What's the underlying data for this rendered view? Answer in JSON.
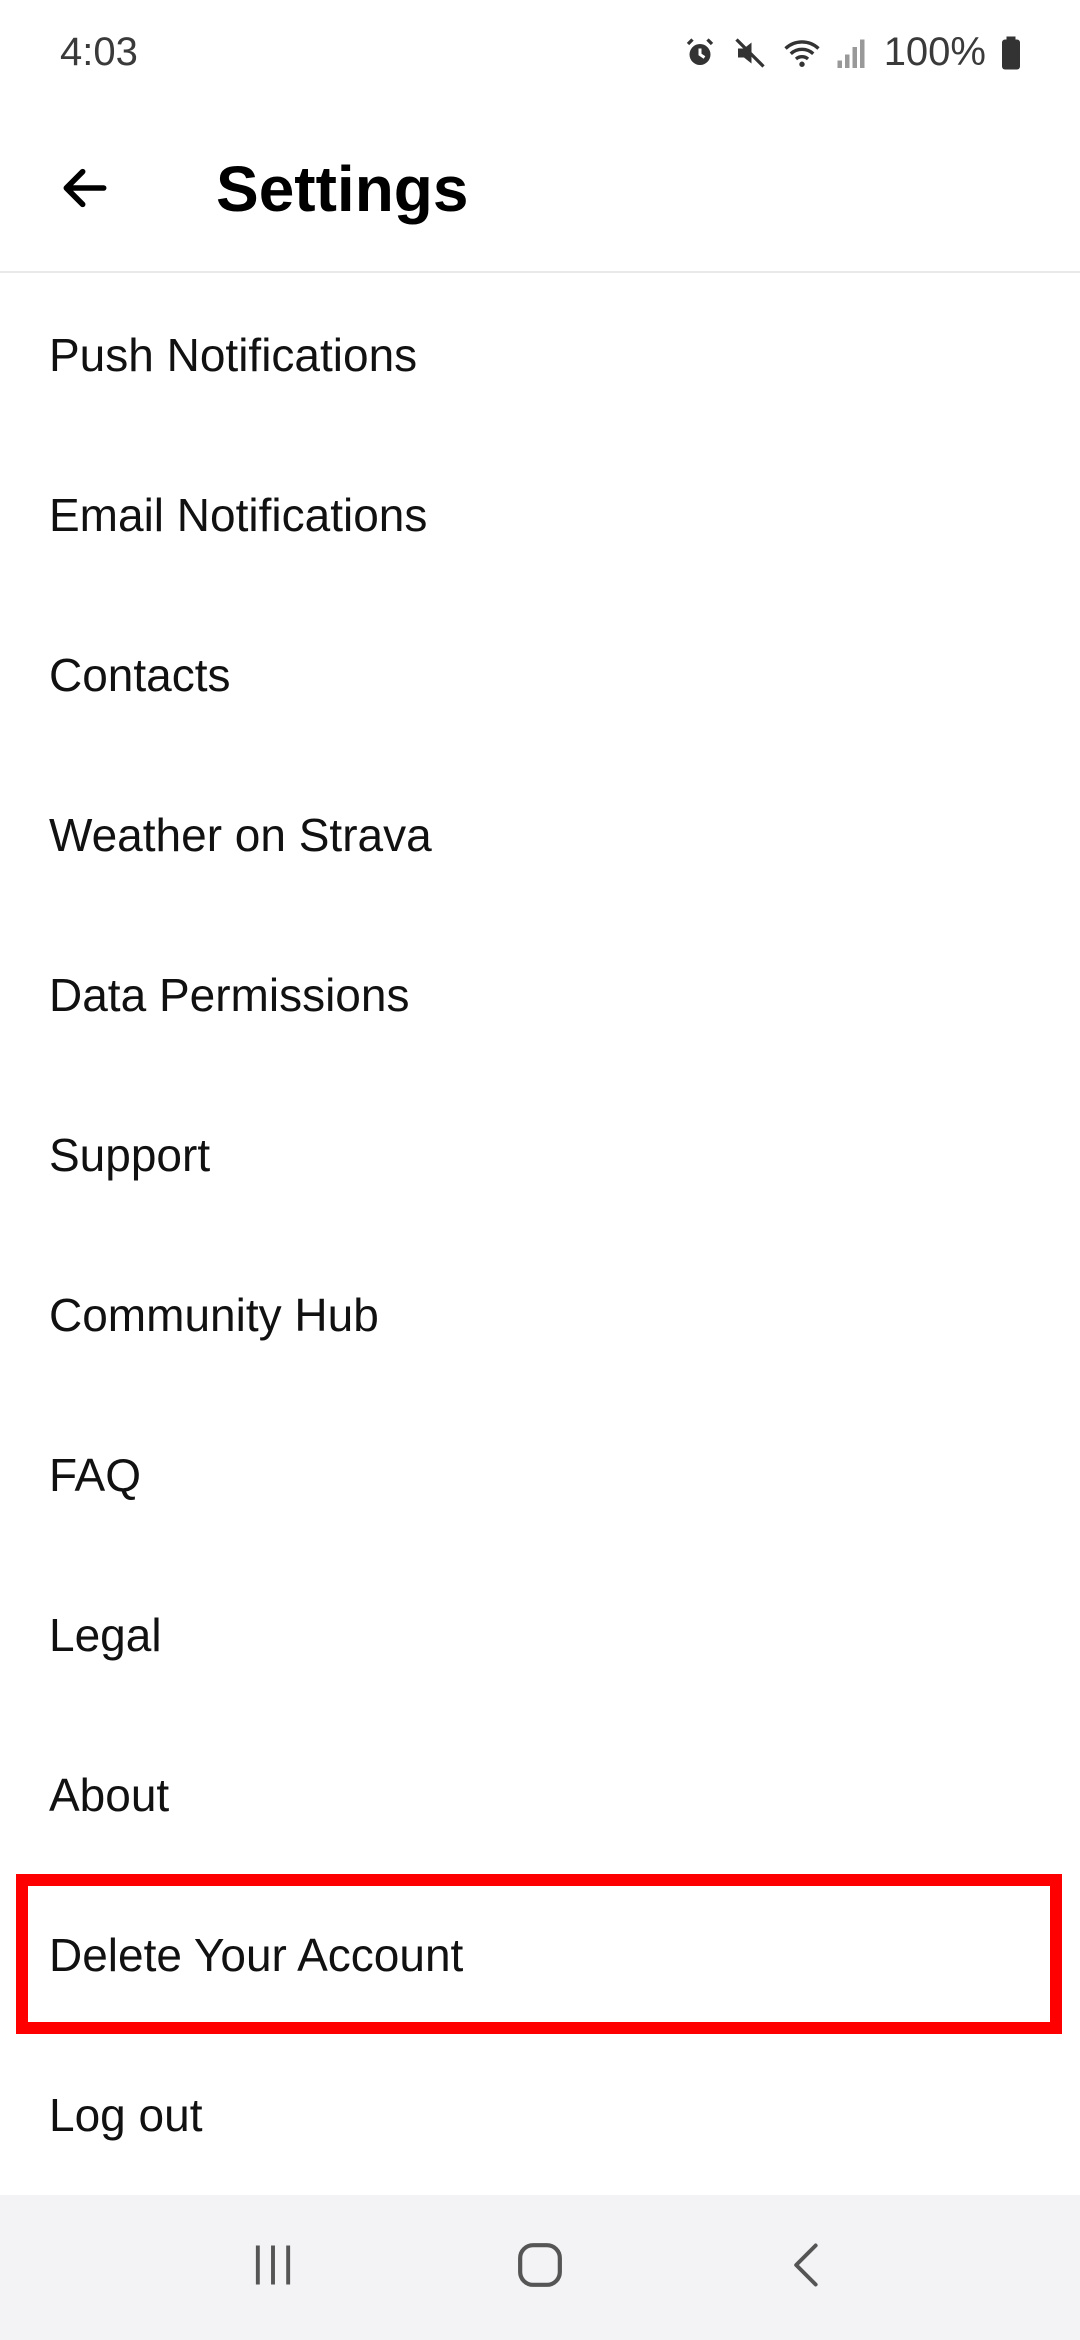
{
  "status_bar": {
    "time": "4:03",
    "battery": "100%",
    "icons": [
      "alarm-icon",
      "mute-icon",
      "wifi-icon",
      "signal-icon",
      "battery-icon"
    ]
  },
  "app_bar": {
    "title": "Settings",
    "back_icon": "arrow-left-icon"
  },
  "settings": {
    "items": [
      {
        "label": "Push Notifications"
      },
      {
        "label": "Email Notifications"
      },
      {
        "label": "Contacts"
      },
      {
        "label": "Weather on Strava"
      },
      {
        "label": "Data Permissions"
      },
      {
        "label": "Support"
      },
      {
        "label": "Community Hub"
      },
      {
        "label": "FAQ"
      },
      {
        "label": "Legal"
      },
      {
        "label": "About"
      },
      {
        "label": "Delete Your Account",
        "highlighted": true
      },
      {
        "label": "Log out"
      }
    ]
  },
  "highlight_color": "#ff0000",
  "nav_bar": {
    "buttons": [
      "recent-apps-icon",
      "home-icon",
      "back-icon"
    ]
  }
}
